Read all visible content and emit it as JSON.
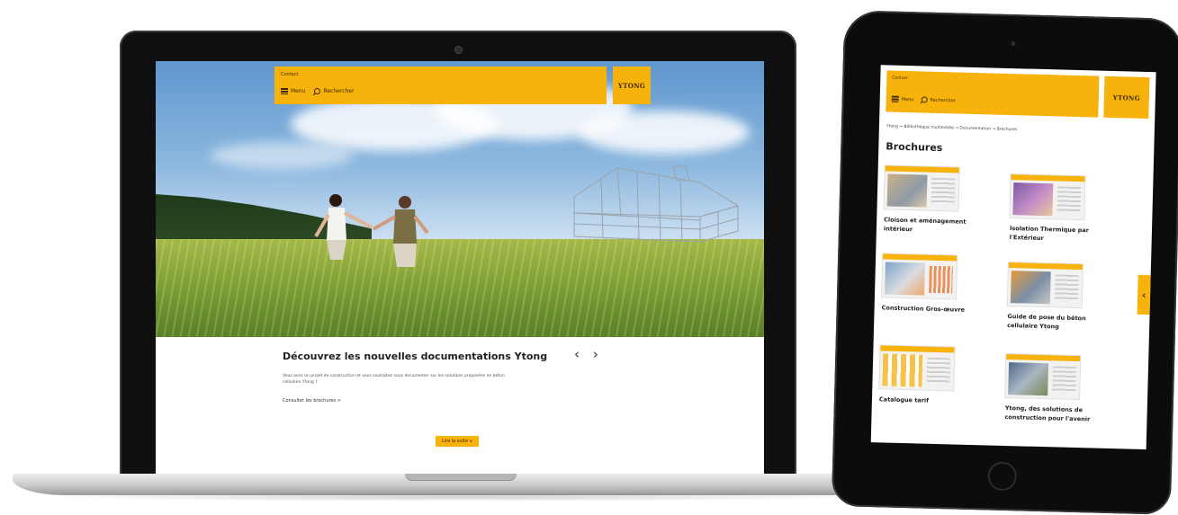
{
  "laptop": {
    "header": {
      "contact": "Contact",
      "menu_label": "Menu",
      "search_label": "Rechercher"
    },
    "logo_text": "YTONG",
    "hero": {
      "title": "Découvrez les nouvelles documentations Ytong",
      "arrows": "‹ ›",
      "description": "Vous avez un projet de construction et vous souhaitez vous documenter sur les solutions proposées en béton cellulaire Ytong ?",
      "link": "Consulter les brochures  >",
      "cta": "Lire la suite  ∨"
    }
  },
  "tablet": {
    "header": {
      "contact": "Contact",
      "menu_label": "Menu",
      "search_label": "Rechercher"
    },
    "logo_text": "YTONG",
    "breadcrumb": "Ytong  →  Bibliothèque multimédia  →  Documentation  →  Brochures",
    "title": "Brochures",
    "side_arrow": "‹",
    "brochures": [
      {
        "label": "Cloison et aménagement intérieur"
      },
      {
        "label": "Isolation Thermique par l'Extérieur"
      },
      {
        "label": "Construction Gros-œuvre"
      },
      {
        "label": "Guide de pose du béton cellulaire Ytong"
      },
      {
        "label": "Catalogue tarif"
      },
      {
        "label": "Ytong, des solutions de construction pour l'avenir"
      }
    ]
  },
  "colors": {
    "brand_yellow": "#f7b20c",
    "brand_text": "#3d2a00",
    "device_black": "#0f0f10"
  }
}
